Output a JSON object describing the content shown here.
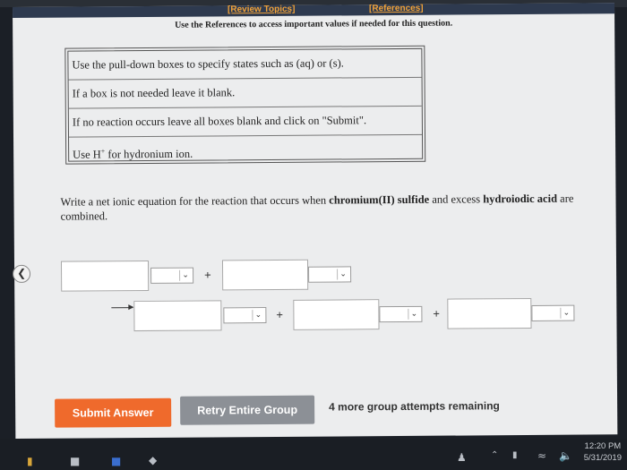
{
  "references_bar": {
    "review_topics": "[Review Topics]",
    "references": "[References]",
    "note": "Use the References to access important values if needed for this question."
  },
  "instructions": [
    "Use the pull-down boxes to specify states such as (aq) or (s).",
    "If a box is not needed leave it blank.",
    "If no reaction occurs leave all boxes blank and click on \"Submit\"."
  ],
  "hydronium": {
    "prefix": "Use H",
    "superscript": "+",
    "suffix": " for hydronium ion."
  },
  "question": {
    "part1": "Write a net ionic equation for the reaction that occurs when ",
    "reactant1": "chromium(II) sulfide",
    "part2": " and excess ",
    "reactant2": "hydroiodic acid",
    "part3": " are combined."
  },
  "equation": {
    "plus": "+"
  },
  "buttons": {
    "submit": "Submit Answer",
    "retry": "Retry Entire Group"
  },
  "remaining": "4 more group attempts remaining",
  "taskbar": {
    "time": "12:20 PM",
    "date": "5/31/2019"
  },
  "colors": {
    "submit_bg": "#ef6a2c",
    "retry_bg": "#8c9096",
    "link_orange": "#f0a23a",
    "ref_bar": "#2e3a4f"
  }
}
